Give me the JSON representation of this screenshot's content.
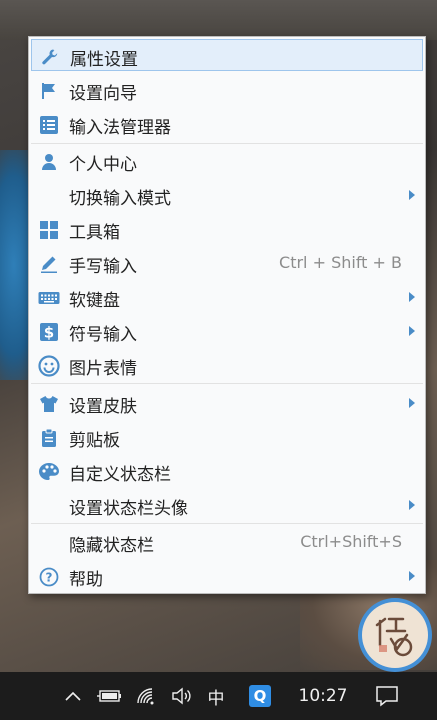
{
  "menu": {
    "items": [
      {
        "label": "属性设置",
        "icon": "wrench-icon"
      },
      {
        "label": "设置向导",
        "icon": "flag-icon"
      },
      {
        "label": "输入法管理器",
        "icon": "list-icon"
      },
      {
        "label": "个人中心",
        "icon": "person-icon"
      },
      {
        "label": "切换输入模式"
      },
      {
        "label": "工具箱",
        "icon": "grid-icon"
      },
      {
        "label": "手写输入",
        "icon": "pen-icon",
        "shortcut": "Ctrl + Shift + B"
      },
      {
        "label": "软键盘",
        "icon": "keyboard-icon"
      },
      {
        "label": "符号输入",
        "icon": "dollar-icon"
      },
      {
        "label": "图片表情",
        "icon": "smiley-icon"
      },
      {
        "label": "设置皮肤",
        "icon": "shirt-icon"
      },
      {
        "label": "剪贴板",
        "icon": "clipboard-icon"
      },
      {
        "label": "自定义状态栏",
        "icon": "palette-icon"
      },
      {
        "label": "设置状态栏头像"
      },
      {
        "label": "隐藏状态栏",
        "shortcut": "Ctrl+Shift+S"
      },
      {
        "label": "帮助",
        "icon": "help-circle-icon"
      }
    ]
  },
  "taskbar": {
    "ime_label": "中",
    "app_badge": "Q",
    "clock": "10:27"
  },
  "colors": {
    "accent": "#4a8cc7",
    "highlight_bg": "#e3eefa",
    "taskbar": "#1c1c1c"
  }
}
